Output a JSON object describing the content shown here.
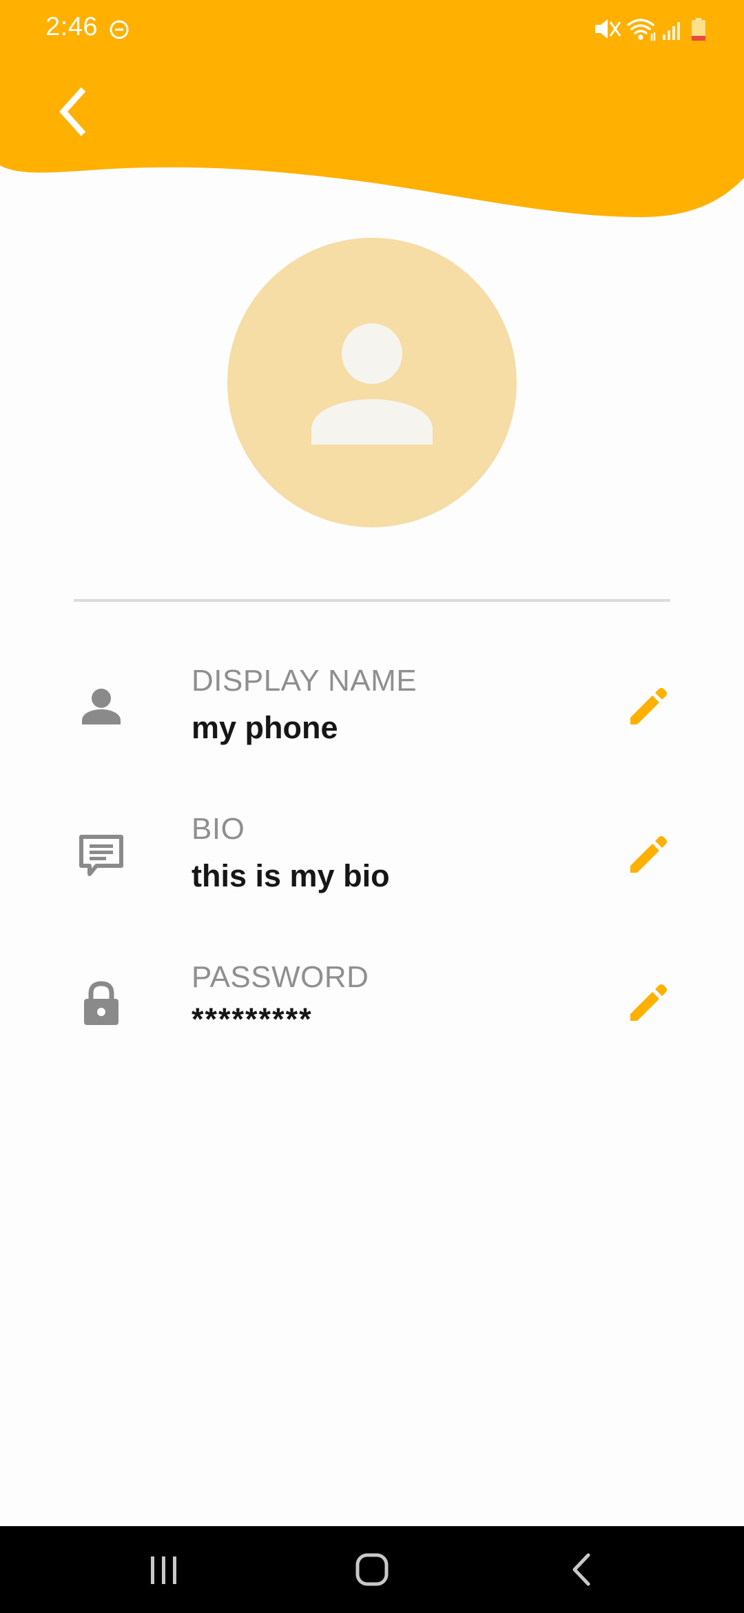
{
  "status_bar": {
    "time": "2:46",
    "icons": [
      "do-not-disturb-icon",
      "mute-icon",
      "wifi-icon",
      "signal-icon",
      "battery-low-icon"
    ]
  },
  "header": {
    "back_icon": "chevron-left-icon",
    "color": "#ffb000"
  },
  "profile": {
    "avatar_icon": "person-silhouette-icon",
    "avatar_color": "#f6dca5",
    "fields": [
      {
        "label": "DISPLAY NAME",
        "value": "my phone",
        "icon": "person-icon",
        "action_icon": "pencil-icon"
      },
      {
        "label": "BIO",
        "value": "this is my bio",
        "icon": "chat-bubble-icon",
        "action_icon": "pencil-icon"
      },
      {
        "label": "PASSWORD",
        "value": "*********",
        "icon": "lock-icon",
        "action_icon": "pencil-icon"
      }
    ]
  },
  "colors": {
    "accent": "#ffb000",
    "label": "#8f8f8f",
    "value": "#161616",
    "icon_gray": "#8a8a8a"
  },
  "nav_bar": {
    "icons": [
      "recents-icon",
      "home-icon",
      "back-icon"
    ]
  }
}
